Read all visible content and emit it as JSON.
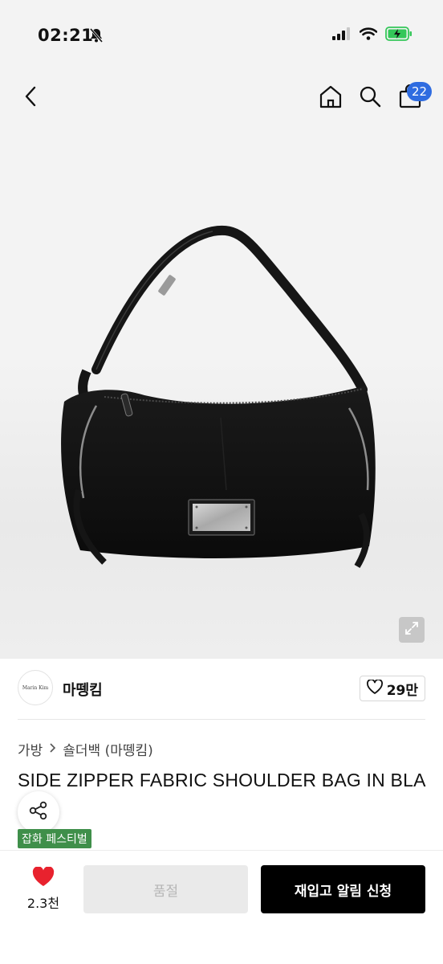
{
  "status_bar": {
    "time": "02:21",
    "icons": [
      "bell-muted-icon",
      "signal-icon",
      "wifi-icon",
      "battery-charging-icon"
    ],
    "battery_color": "#34c759"
  },
  "nav": {
    "icons": [
      "back-chevron-icon",
      "home-icon",
      "search-icon",
      "shopping-bag-icon"
    ],
    "cart_count": "22",
    "badge_color": "#2f6ce0"
  },
  "product_image": {
    "subject": "black fabric shoulder bag with side zippers and metal plate",
    "expand_icon": "expand-icon"
  },
  "brand": {
    "logo_text": "Marin Kim",
    "name": "마뗑킴",
    "like_count": "29만"
  },
  "breadcrumb": [
    "가방",
    "숄더백 (마뗑킴)"
  ],
  "product": {
    "title": "SIDE ZIPPER FABRIC SHOULDER BAG IN BLA"
  },
  "share_icon": "share-icon",
  "tag": {
    "label": "잡화 페스티벌",
    "color": "#3f8f4a"
  },
  "bottom_bar": {
    "wish_count": "2.3천",
    "soldout_label": "품절",
    "restock_label": "재입고 알림 신청"
  }
}
